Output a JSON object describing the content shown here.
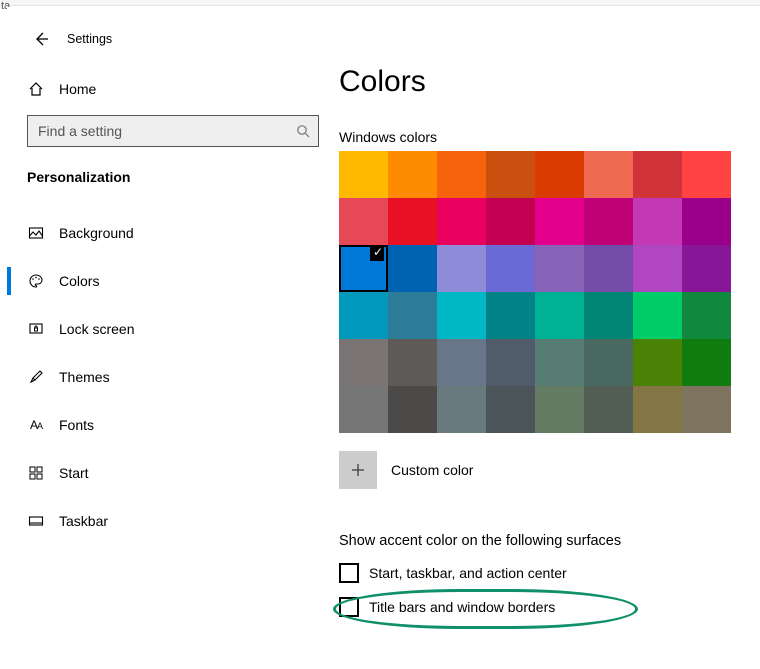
{
  "tab_fragment": "ta",
  "app_title": "Settings",
  "home_label": "Home",
  "search_placeholder": "Find a setting",
  "category_title": "Personalization",
  "nav": [
    {
      "label": "Background",
      "icon": "picture"
    },
    {
      "label": "Colors",
      "icon": "palette",
      "selected": true
    },
    {
      "label": "Lock screen",
      "icon": "lock"
    },
    {
      "label": "Themes",
      "icon": "brush"
    },
    {
      "label": "Fonts",
      "icon": "fonts"
    },
    {
      "label": "Start",
      "icon": "start"
    },
    {
      "label": "Taskbar",
      "icon": "taskbar"
    }
  ],
  "page_title": "Colors",
  "grid_label": "Windows colors",
  "colors": [
    "#FFB900",
    "#FF8C00",
    "#F7630C",
    "#CA5010",
    "#DA3B01",
    "#EF6950",
    "#D13438",
    "#FF4343",
    "#E74856",
    "#E81123",
    "#EA005E",
    "#C30052",
    "#E3008C",
    "#BF0077",
    "#C239B3",
    "#9A0089",
    "#0078D7",
    "#0063B1",
    "#8E8CD8",
    "#6B69D6",
    "#8764B8",
    "#744DA9",
    "#B146C2",
    "#881798",
    "#0099BC",
    "#2D7D9A",
    "#00B7C3",
    "#038387",
    "#00B294",
    "#018574",
    "#00CC6A",
    "#10893E",
    "#7A7574",
    "#5D5A58",
    "#68768A",
    "#515C6B",
    "#567C73",
    "#486860",
    "#498205",
    "#107C10",
    "#767676",
    "#4C4A48",
    "#69797E",
    "#4A5459",
    "#647C64",
    "#525E54",
    "#847545",
    "#7E735F"
  ],
  "selected_color_index": 16,
  "custom_color_label": "Custom color",
  "section_label": "Show accent color on the following surfaces",
  "check1_label": "Start, taskbar, and action center",
  "check2_label": "Title bars and window borders"
}
